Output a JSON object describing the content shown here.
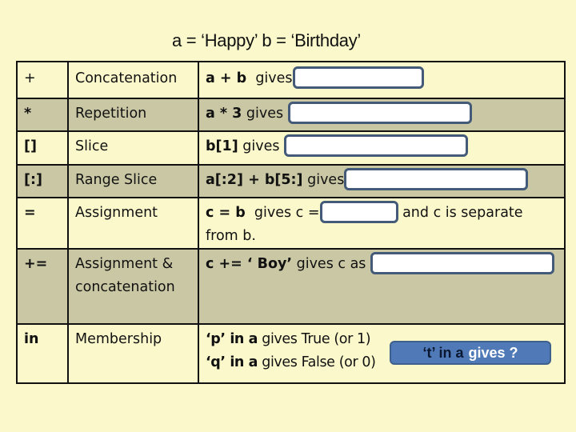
{
  "slide": {
    "title": "a = ‘Happy’   b = ‘Birthday’"
  },
  "colors": {
    "background": "#fbf9cb",
    "row_dark": "#cac8a4",
    "answer_box_border": "#435a78",
    "quiz_button": "#4f7ab7"
  },
  "rows": [
    {
      "symbol": "+",
      "name": "Concatenation",
      "example_bold": "a + b",
      "example_text": "  gives",
      "answer": ""
    },
    {
      "symbol": "*",
      "name": "Repetition",
      "example_bold": "a * 3",
      "example_text": " gives",
      "answer": ""
    },
    {
      "symbol": "[]",
      "name": "Slice",
      "example_bold": "b[1]",
      "example_text": " gives ",
      "answer": ""
    },
    {
      "symbol": "[:]",
      "name": "Range Slice",
      "example_bold": "a[:2] + b[5:]",
      "example_text": " gives",
      "answer": ""
    },
    {
      "symbol": "=",
      "name": "Assignment",
      "example_bold": "c = b",
      "example_text": "  gives c =",
      "answer": "",
      "example_after": "and c is separate",
      "example_line2": "from b."
    },
    {
      "symbol": "+=",
      "name_line1": "Assignment &",
      "name_line2": "concatenation",
      "example_bold": "c += ‘ Boy’",
      "example_text": " gives c as ",
      "answer": ""
    },
    {
      "symbol": "in",
      "name": "Membership",
      "line1_bold": "‘p’ in a",
      "line1_text": " gives True (or 1)",
      "line2_bold": "‘q’ in a",
      "line2_text": " gives False (or 0)",
      "quiz_part1": "‘t’ in a",
      "quiz_part2": "gives ?"
    }
  ]
}
